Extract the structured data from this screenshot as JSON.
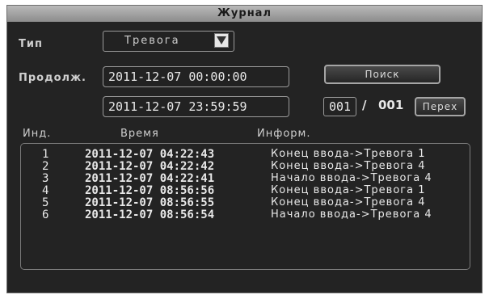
{
  "window": {
    "title": "Журнал"
  },
  "filters": {
    "type_label": "Тип",
    "type_value": "Тревога",
    "duration_label": "Продолж.",
    "start_datetime": "2011-12-07 00:00:00",
    "end_datetime": "2011-12-07 23:59:59"
  },
  "buttons": {
    "search_label": "Поиск",
    "goto_label": "Перех"
  },
  "pagination": {
    "current_page": "001",
    "separator": "/",
    "total_pages": "001"
  },
  "table": {
    "headers": [
      "Инд.",
      "Время",
      "Информ."
    ],
    "rows": [
      {
        "index": "1",
        "time": "2011-12-07 04:22:43",
        "info": "Конец ввода->Тревога 1"
      },
      {
        "index": "2",
        "time": "2011-12-07 04:22:42",
        "info": "Конец ввода->Тревога 4"
      },
      {
        "index": "3",
        "time": "2011-12-07 04:22:41",
        "info": "Начало ввода->Тревога 4"
      },
      {
        "index": "4",
        "time": "2011-12-07 08:56:56",
        "info": "Конец ввода->Тревога 1"
      },
      {
        "index": "5",
        "time": "2011-12-07 08:56:55",
        "info": "Конец ввода->Тревога 4"
      },
      {
        "index": "6",
        "time": "2011-12-07 08:56:54",
        "info": "Начало ввода->Тревога 4"
      }
    ]
  },
  "icons": {
    "dropdown": "chevron-down-icon"
  }
}
